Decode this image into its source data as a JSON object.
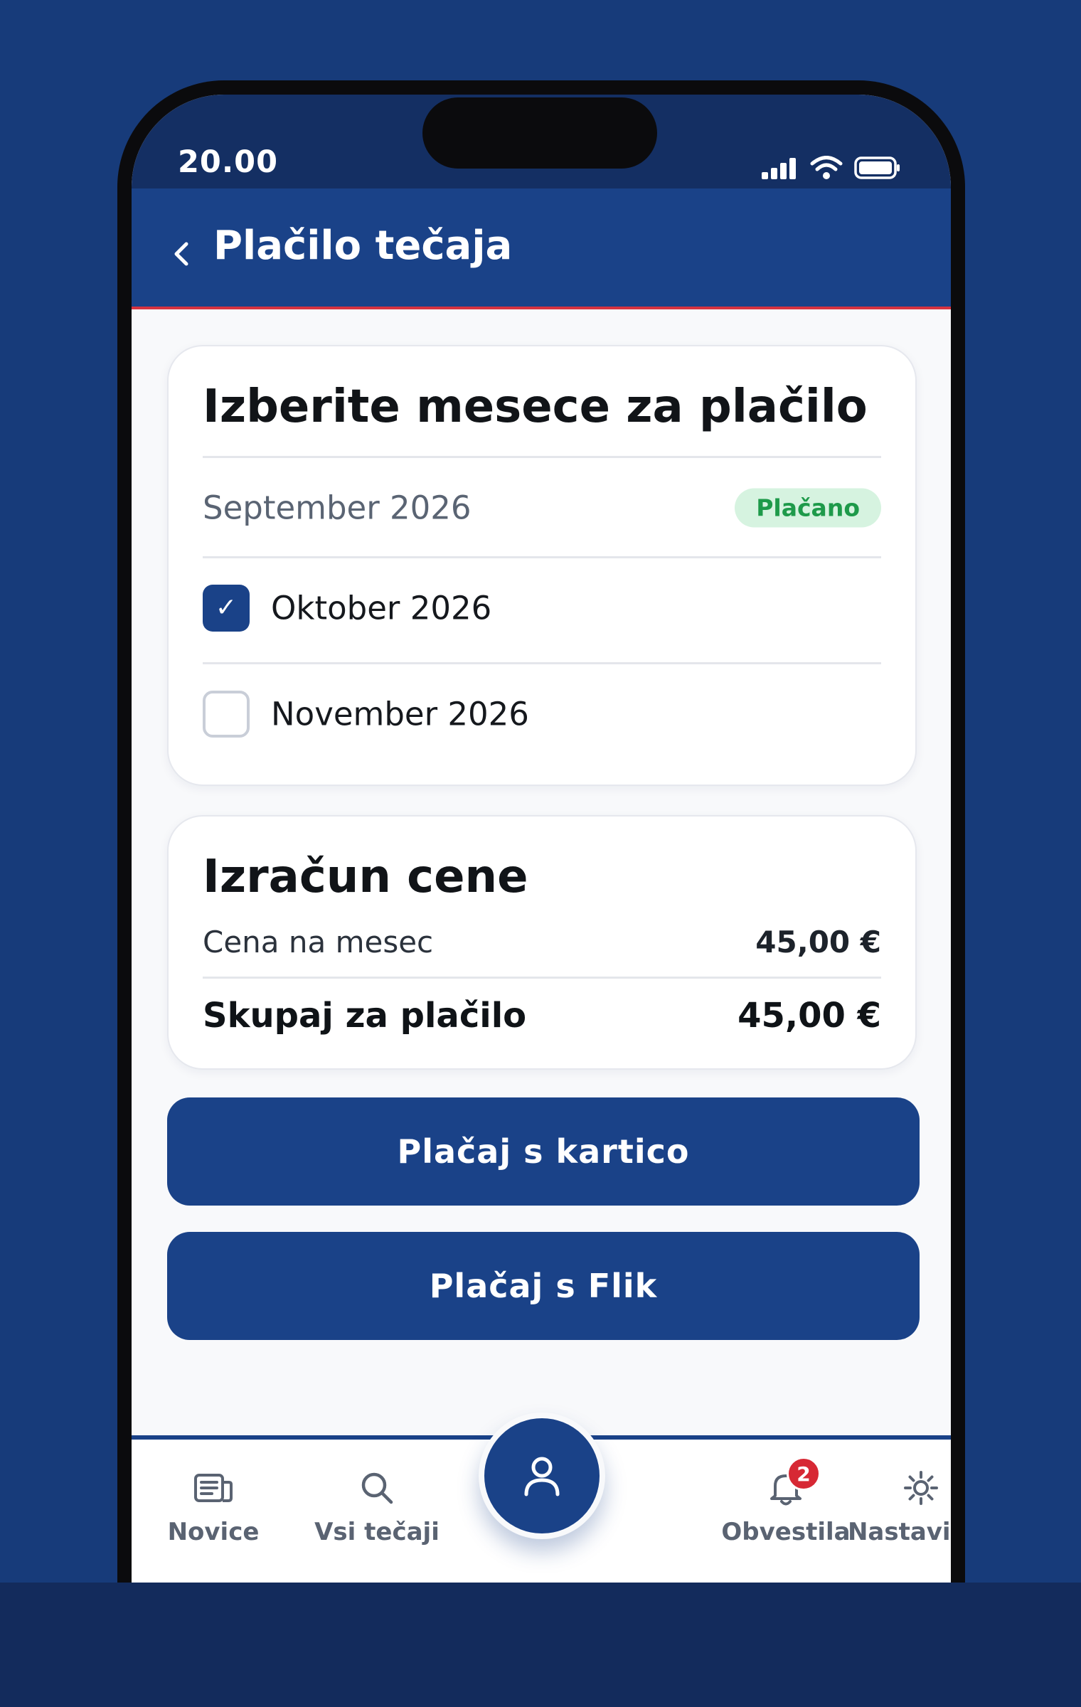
{
  "status_bar": {
    "time": "20.00"
  },
  "header": {
    "title": "Plačilo tečaja"
  },
  "months_card": {
    "title": "Izberite mesece za plačilo",
    "months": [
      {
        "label": "September 2026",
        "status": "paid",
        "badge": "Plačano"
      },
      {
        "label": "Oktober 2026",
        "status": "checked"
      },
      {
        "label": "November 2026",
        "status": "unchecked"
      }
    ],
    "check_glyph": "✓"
  },
  "price_card": {
    "title": "Izračun cene",
    "per_month_label": "Cena na mesec",
    "per_month_value": "45,00 €",
    "total_label": "Skupaj za plačilo",
    "total_value": "45,00 €"
  },
  "buttons": {
    "pay_card": "Plačaj s kartico",
    "pay_flik": "Plačaj s Flik"
  },
  "bottom_nav": {
    "items": [
      {
        "label": "Novice",
        "icon": "news-icon"
      },
      {
        "label": "Vsi tečaji",
        "icon": "search-icon"
      },
      {
        "label": "",
        "icon": "profile-icon"
      },
      {
        "label": "Obvestila",
        "icon": "bell-icon",
        "badge": "2"
      },
      {
        "label": "Nastavitve",
        "icon": "settings-icon"
      }
    ]
  },
  "colors": {
    "primary": "#1a4288",
    "status_bar": "#142f63",
    "accent_red": "#d63340",
    "paid_green": "#1e9a4a",
    "paid_bg": "#d6f3e0"
  }
}
